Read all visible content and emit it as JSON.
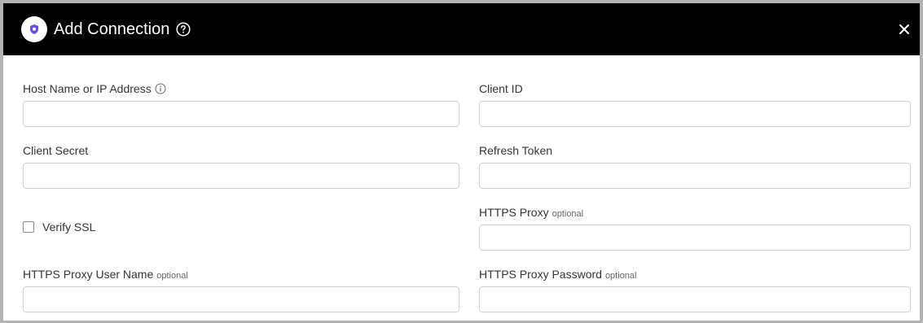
{
  "dialog": {
    "title": "Add Connection",
    "close_icon": "close-icon",
    "help_icon": "help-circle-icon",
    "logo_icon": "shield-logo-icon",
    "accent_color": "#6b4fd8"
  },
  "fields": {
    "host": {
      "label": "Host Name or IP Address",
      "value": "",
      "info_icon": "info-icon"
    },
    "client_id": {
      "label": "Client ID",
      "value": ""
    },
    "client_secret": {
      "label": "Client Secret",
      "value": ""
    },
    "refresh_token": {
      "label": "Refresh Token",
      "value": ""
    },
    "verify_ssl": {
      "label": "Verify SSL",
      "checked": false
    },
    "https_proxy": {
      "label": "HTTPS Proxy",
      "hint": "optional",
      "value": ""
    },
    "proxy_user": {
      "label": "HTTPS Proxy User Name",
      "hint": "optional",
      "value": ""
    },
    "proxy_password": {
      "label": "HTTPS Proxy Password",
      "hint": "optional",
      "value": ""
    }
  }
}
